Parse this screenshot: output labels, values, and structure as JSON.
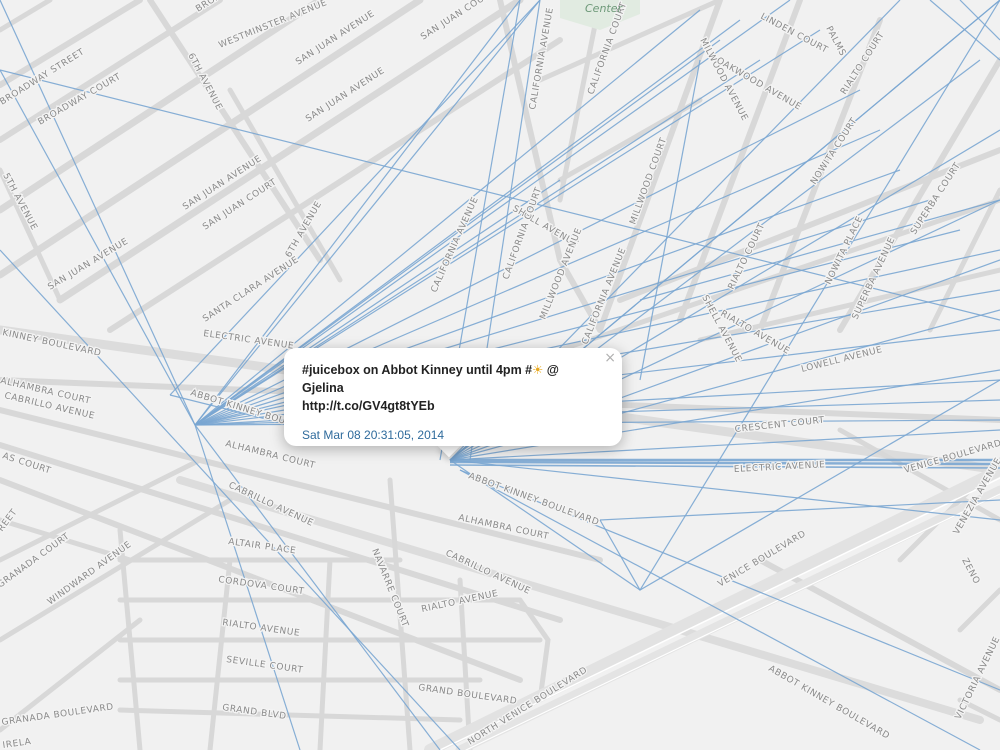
{
  "map": {
    "poi_labels": [
      "Center"
    ],
    "street_labels": [
      "BROADWAY",
      "6TH AVENUE",
      "WESTMINSTER AVENUE",
      "SAN JUAN AVENUE",
      "CALIFORNIA AVENUE",
      "MILWOOD AVENUE",
      "LINDEN COURT",
      "PALMS",
      "BROADWAY STREET",
      "BROADWAY COURT",
      "SAN JUAN COURT",
      "CALIFORNIA COURT",
      "OAKWOOD AVENUE",
      "RIALTO COURT",
      "SAN JUAN AVENUE",
      "5TH AVENUE",
      "SAN JUAN AVENUE",
      "SAN JUAN COURT",
      "MILLWOOD COURT",
      "SAN JUAN AVENUE",
      "CALIFORNIA AVENUE",
      "SHELL AVENUE",
      "6TH AVENUE",
      "CALIFORNIA COURT",
      "MILLWOOD AVENUE",
      "RIALTO COURT",
      "NOWITA COURT",
      "SUPERBA COURT",
      "SANTA CLARA AVENUE",
      "ELECTRIC AVENUE",
      "CALIFORNIA AVENUE",
      "SHELL AVENUE",
      "RIALTO AVENUE",
      "NOWITA PLACE",
      "SUPERBA AVENUE",
      "KINNEY BOULEVARD",
      "ALHAMBRA COURT",
      "ABBOT KINNEY BOULEVARD",
      "COURT",
      "LOWELL AVENUE",
      "CABRILLO AVENUE",
      "ALHAMBRA COURT",
      "CRESCENT COURT",
      "ELECTRIC AVENUE",
      "VENICE BOULEVARD",
      "AS COURT",
      "CABRILLO AVENUE",
      "ABBOT KINNEY BOULEVARD",
      "REET",
      "GRANADA COURT",
      "WINDWARD AVENUE",
      "ALTAIR PLACE",
      "ALHAMBRA COURT",
      "VENICE BOULEVARD",
      "VENEZIA AVENUE",
      "CORDOVA COURT",
      "NAVARRE COURT",
      "CABRILLO AVENUE",
      "ZENO",
      "RIALTO AVENUE",
      "RIALTO AVENUE",
      "SEVILLE COURT",
      "GRAND BOULEVARD",
      "GRAND BLVD",
      "ABBOT KINNEY BOULEVARD",
      "VICTORIA AVENUE",
      "GRANADA BOULEVARD",
      "NORTH VENICE BOULEVARD",
      "IRELA"
    ]
  },
  "popup": {
    "tweet_before_emoji": "#juicebox on Abbot Kinney until 4pm #",
    "emoji": "☀",
    "tweet_after_emoji": " @ Gjelina",
    "tweet_link": "http://t.co/GV4gt8tYEb",
    "timestamp": "Sat Mar 08 20:31:05, 2014",
    "close_glyph": "×"
  },
  "colors": {
    "map_background": "#f1f1f1",
    "minor_street": "#d7d7d7",
    "major_street": "#dedede",
    "track_line": "#7aa6d2",
    "timestamp_link": "#2f6b9c"
  }
}
